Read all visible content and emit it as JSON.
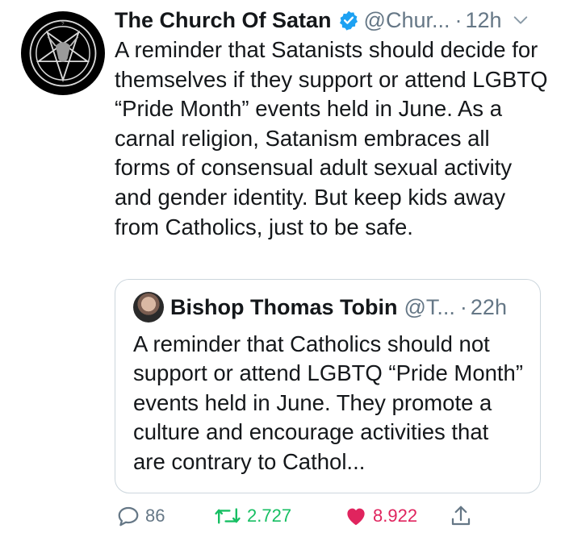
{
  "tweet": {
    "display_name": "The Church Of Satan",
    "handle": "@Chur...",
    "separator": "·",
    "time": "12h",
    "text": "A reminder that Satanists should decide for themselves if they support or attend LGBTQ “Pride Month” events held in June. As a carnal religion, Satanism embraces all forms of consensual adult sexual activity and gender identity. But keep kids away from Catholics, just to be safe."
  },
  "quoted": {
    "display_name": "Bishop Thomas Tobin",
    "handle": "@T...",
    "separator": "·",
    "time": "22h",
    "text": "A reminder that Catholics should not support or attend LGBTQ “Pride Month” events held in June. They promote a culture and encourage activities that are contrary to Cathol..."
  },
  "actions": {
    "reply_count": "86",
    "retweet_count": "2.727",
    "like_count": "8.922"
  },
  "icons": {
    "avatar": "baphomet-sigil-icon",
    "verified": "verified-badge-icon",
    "menu": "chevron-down-icon",
    "reply": "reply-icon",
    "retweet": "retweet-icon",
    "like": "heart-icon",
    "share": "share-icon"
  },
  "colors": {
    "text": "#14171a",
    "secondary": "#657786",
    "verified": "#1da1f2",
    "retweet": "#17bf63",
    "like": "#e0245e",
    "border": "#ccd6dd"
  }
}
